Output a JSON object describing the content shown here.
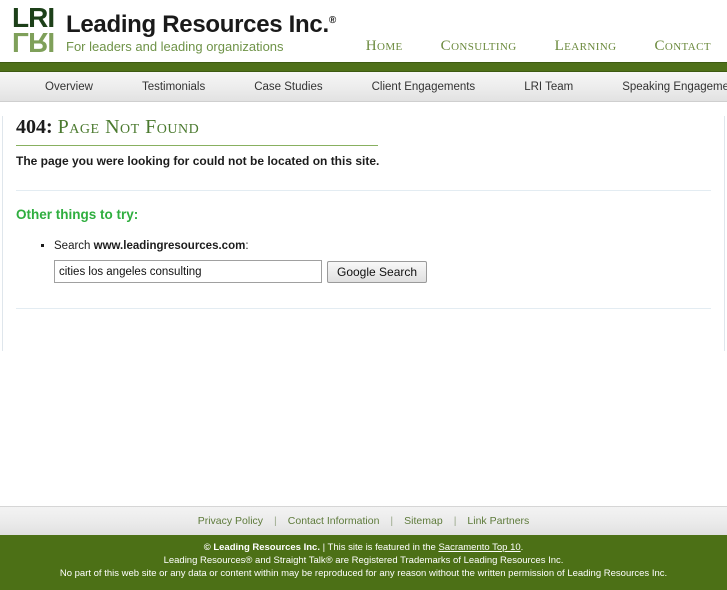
{
  "brand": {
    "mark_top": "LRI",
    "mark_bottom": "LRI",
    "title": "Leading Resources Inc.",
    "registered": "®",
    "tagline": "For leaders and leading organizations",
    "colors": {
      "dark_green": "#1d4019",
      "light_green": "#7fa05a",
      "bar_green": "#4f7019",
      "footer_green": "#4c7016",
      "accent_green": "#2fae3f"
    }
  },
  "topnav": {
    "items": [
      {
        "label": "Home"
      },
      {
        "label": "Consulting"
      },
      {
        "label": "Learning"
      },
      {
        "label": "Contact"
      }
    ]
  },
  "subnav": {
    "items": [
      {
        "label": "Overview"
      },
      {
        "label": "Testimonials"
      },
      {
        "label": "Case Studies"
      },
      {
        "label": "Client Engagements"
      },
      {
        "label": "LRI Team"
      },
      {
        "label": "Speaking Engagements"
      }
    ]
  },
  "main": {
    "error_code": "404:",
    "error_phrase": "Page Not Found",
    "lead": "The page you were looking for could not be located on this site.",
    "subhead": "Other things to try:",
    "list_item_prefix": "Search ",
    "list_item_site": "www.leadingresources.com",
    "list_item_suffix": ":",
    "search_value": "cities los angeles consulting",
    "search_placeholder": "",
    "search_button": "Google Search"
  },
  "footer": {
    "links": [
      {
        "label": "Privacy Policy"
      },
      {
        "label": "Contact Information"
      },
      {
        "label": "Sitemap"
      },
      {
        "label": "Link Partners"
      }
    ],
    "divider": "|",
    "legal_line1_bold": "© Leading Resources Inc.",
    "legal_line1_rest": " | This site is featured in the ",
    "legal_line1_link": "Sacramento Top 10",
    "legal_line1_end": ".",
    "legal_line2": "Leading Resources® and Straight Talk® are Registered Trademarks of Leading Resources Inc.",
    "legal_line3": "No part of this web site or any data or content within may be reproduced for any reason without the written permission of Leading Resources Inc."
  }
}
